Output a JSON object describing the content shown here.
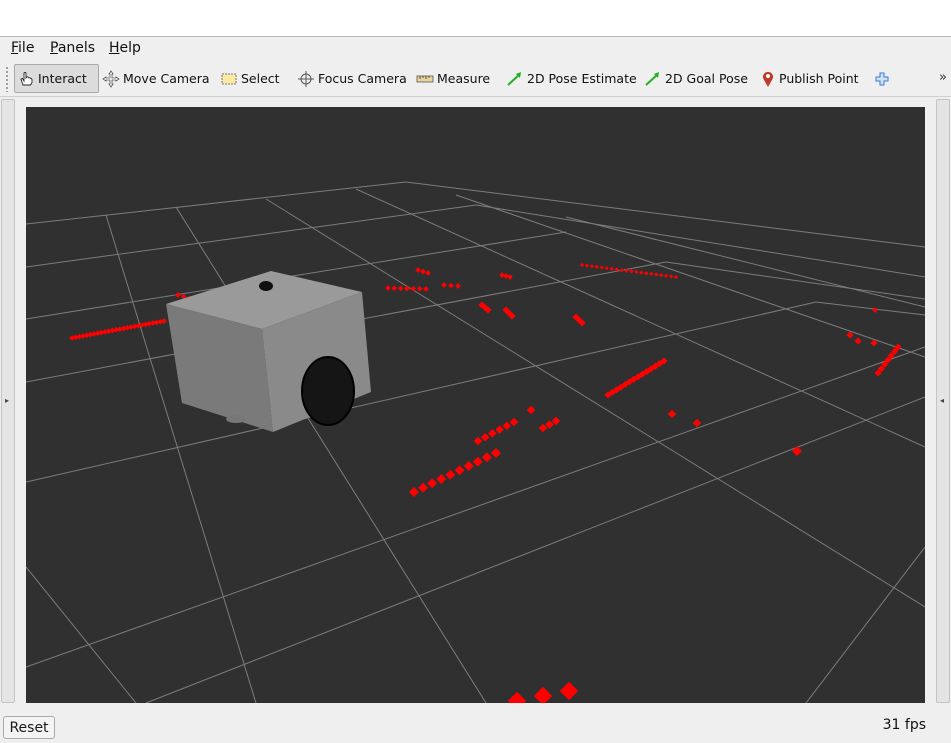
{
  "menu": {
    "file": {
      "accel": "F",
      "rest": "ile"
    },
    "panels": {
      "accel": "P",
      "rest": "anels"
    },
    "help": {
      "accel": "H",
      "rest": "elp"
    }
  },
  "toolbar": {
    "interact": "Interact",
    "move_camera": "Move Camera",
    "select": "Select",
    "focus_camera": "Focus Camera",
    "measure": "Measure",
    "pose_estimate": "2D Pose Estimate",
    "goal_pose": "2D Goal Pose",
    "publish_point": "Publish Point",
    "overflow": "»"
  },
  "icons": {
    "interact": "hand-pointer-icon",
    "move_camera": "move-camera-icon",
    "select": "select-rectangle-icon",
    "focus_camera": "crosshair-icon",
    "measure": "ruler-icon",
    "pose_estimate": "green-arrow-icon",
    "goal_pose": "green-arrow-icon",
    "publish_point": "map-pin-icon",
    "add_tool": "plus-icon"
  },
  "colors": {
    "viewport_bg": "#303030",
    "grid": "#8a8a8a",
    "laser_points": "#ff0000",
    "robot_body": "#8a8a8a",
    "pose_arrow": "#22b022",
    "pin": "#c0392b",
    "plus": "#3a7bd5"
  },
  "side_panels": {
    "left_arrow": "▸",
    "right_arrow": "◂"
  },
  "footer": {
    "reset": "Reset",
    "fps": "31 fps"
  }
}
